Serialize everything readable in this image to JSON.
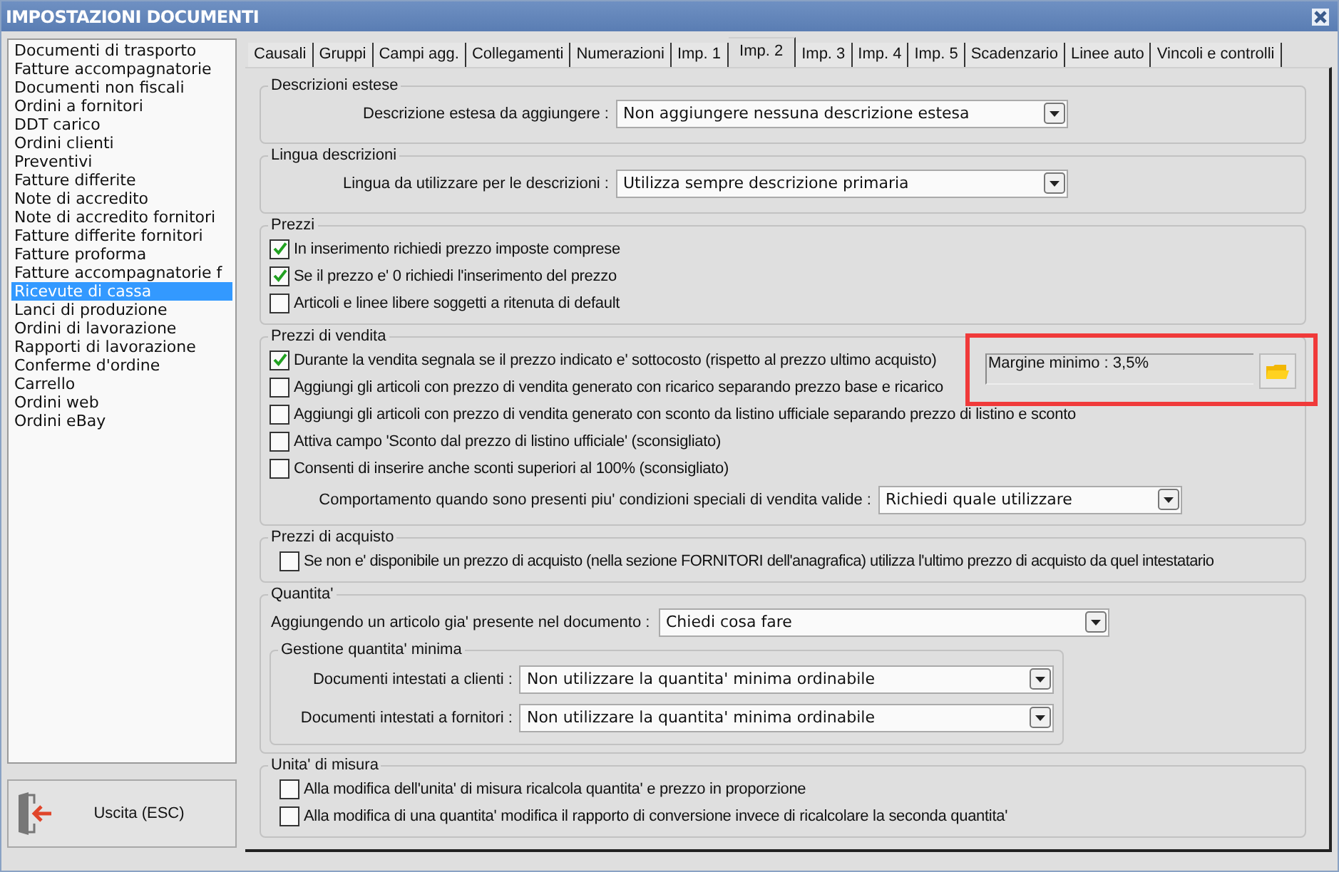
{
  "window": {
    "title": "IMPOSTAZIONI DOCUMENTI"
  },
  "document_types": [
    {
      "label": "Documenti di trasporto",
      "selected": false
    },
    {
      "label": "Fatture accompagnatorie",
      "selected": false
    },
    {
      "label": "Documenti non fiscali",
      "selected": false
    },
    {
      "label": "Ordini a fornitori",
      "selected": false
    },
    {
      "label": "DDT carico",
      "selected": false
    },
    {
      "label": "Ordini clienti",
      "selected": false
    },
    {
      "label": "Preventivi",
      "selected": false
    },
    {
      "label": "Fatture differite",
      "selected": false
    },
    {
      "label": "Note di accredito",
      "selected": false
    },
    {
      "label": "Note di accredito fornitori",
      "selected": false
    },
    {
      "label": "Fatture differite fornitori",
      "selected": false
    },
    {
      "label": "Fatture proforma",
      "selected": false
    },
    {
      "label": "Fatture accompagnatorie f",
      "selected": false
    },
    {
      "label": "Ricevute di cassa",
      "selected": true
    },
    {
      "label": "Lanci di produzione",
      "selected": false
    },
    {
      "label": "Ordini di lavorazione",
      "selected": false
    },
    {
      "label": "Rapporti di lavorazione",
      "selected": false
    },
    {
      "label": "Conferme d'ordine",
      "selected": false
    },
    {
      "label": "Carrello",
      "selected": false
    },
    {
      "label": "Ordini web",
      "selected": false
    },
    {
      "label": "Ordini eBay",
      "selected": false
    }
  ],
  "exit_button": {
    "label": "Uscita (ESC)"
  },
  "tabs": [
    {
      "label": "Causali",
      "selected": false
    },
    {
      "label": "Gruppi",
      "selected": false
    },
    {
      "label": "Campi agg.",
      "selected": false
    },
    {
      "label": "Collegamenti",
      "selected": false
    },
    {
      "label": "Numerazioni",
      "selected": false
    },
    {
      "label": "Imp. 1",
      "selected": false
    },
    {
      "label": "Imp. 2",
      "selected": true
    },
    {
      "label": "Imp. 3",
      "selected": false
    },
    {
      "label": "Imp. 4",
      "selected": false
    },
    {
      "label": "Imp. 5",
      "selected": false
    },
    {
      "label": "Scadenzario",
      "selected": false
    },
    {
      "label": "Linee auto",
      "selected": false
    },
    {
      "label": "Vincoli e controlli",
      "selected": false
    }
  ],
  "sections": [
    {
      "title": "Descrizioni estese",
      "items": [
        {
          "kind": "select",
          "label": "Descrizione estesa da aggiungere :",
          "value": "Non aggiungere nessuna descrizione estesa"
        }
      ]
    },
    {
      "title": "Lingua descrizioni",
      "items": [
        {
          "kind": "select",
          "label": "Lingua da utilizzare per le descrizioni :",
          "value": "Utilizza sempre descrizione primaria"
        }
      ]
    },
    {
      "title": "Prezzi",
      "items": [
        {
          "kind": "checkbox",
          "label": "In inserimento richiedi prezzo imposte comprese",
          "checked": true
        },
        {
          "kind": "checkbox",
          "label": "Se il prezzo e' 0 richiedi l'inserimento del prezzo",
          "checked": true
        },
        {
          "kind": "checkbox",
          "label": "Articoli e linee libere soggetti a ritenuta di default",
          "checked": false
        }
      ]
    },
    {
      "title": "Prezzi di vendita",
      "margin_field": {
        "value": "Margine minimo : 3,5%",
        "highlighted": true
      },
      "items": [
        {
          "kind": "checkbox",
          "label": "Durante la vendita segnala se il prezzo indicato e' sottocosto (rispetto al prezzo ultimo acquisto)",
          "checked": true
        },
        {
          "kind": "checkbox",
          "label": "Aggiungi gli articoli con prezzo di vendita generato con ricarico separando prezzo base e ricarico",
          "checked": false
        },
        {
          "kind": "checkbox",
          "label": "Aggiungi gli articoli con prezzo di vendita generato con sconto da listino ufficiale separando prezzo di listino e sconto",
          "checked": false
        },
        {
          "kind": "checkbox",
          "label": "Attiva campo 'Sconto dal prezzo di listino ufficiale' (sconsigliato)",
          "checked": false
        },
        {
          "kind": "checkbox",
          "label": "Consenti di inserire anche sconti superiori al 100% (sconsigliato)",
          "checked": false
        },
        {
          "kind": "select",
          "label": "Comportamento quando sono presenti piu' condizioni speciali di vendita valide :",
          "value": "Richiedi quale utilizzare"
        }
      ]
    },
    {
      "title": "Prezzi di acquisto",
      "items": [
        {
          "kind": "checkbox",
          "label": "Se non e' disponibile un prezzo di acquisto (nella sezione FORNITORI dell'anagrafica) utilizza l'ultimo prezzo di acquisto da quel intestatario",
          "checked": false
        }
      ]
    },
    {
      "title": "Quantita'",
      "items": [
        {
          "kind": "select",
          "label": "Aggiungendo un articolo gia' presente nel documento :",
          "value": "Chiedi cosa fare"
        },
        {
          "kind": "group",
          "title": "Gestione quantita' minima",
          "items": [
            {
              "kind": "select",
              "label": "Documenti intestati a clienti :",
              "value": "Non utilizzare la quantita' minima ordinabile"
            },
            {
              "kind": "select",
              "label": "Documenti intestati a fornitori :",
              "value": "Non utilizzare la quantita' minima ordinabile"
            }
          ]
        }
      ]
    },
    {
      "title": "Unita' di misura",
      "items": [
        {
          "kind": "checkbox",
          "label": "Alla modifica dell'unita' di misura ricalcola quantita' e prezzo in proporzione",
          "checked": false
        },
        {
          "kind": "checkbox",
          "label": "Alla modifica di una quantita' modifica il rapporto di conversione invece di ricalcolare la seconda quantita'",
          "checked": false
        }
      ]
    }
  ]
}
